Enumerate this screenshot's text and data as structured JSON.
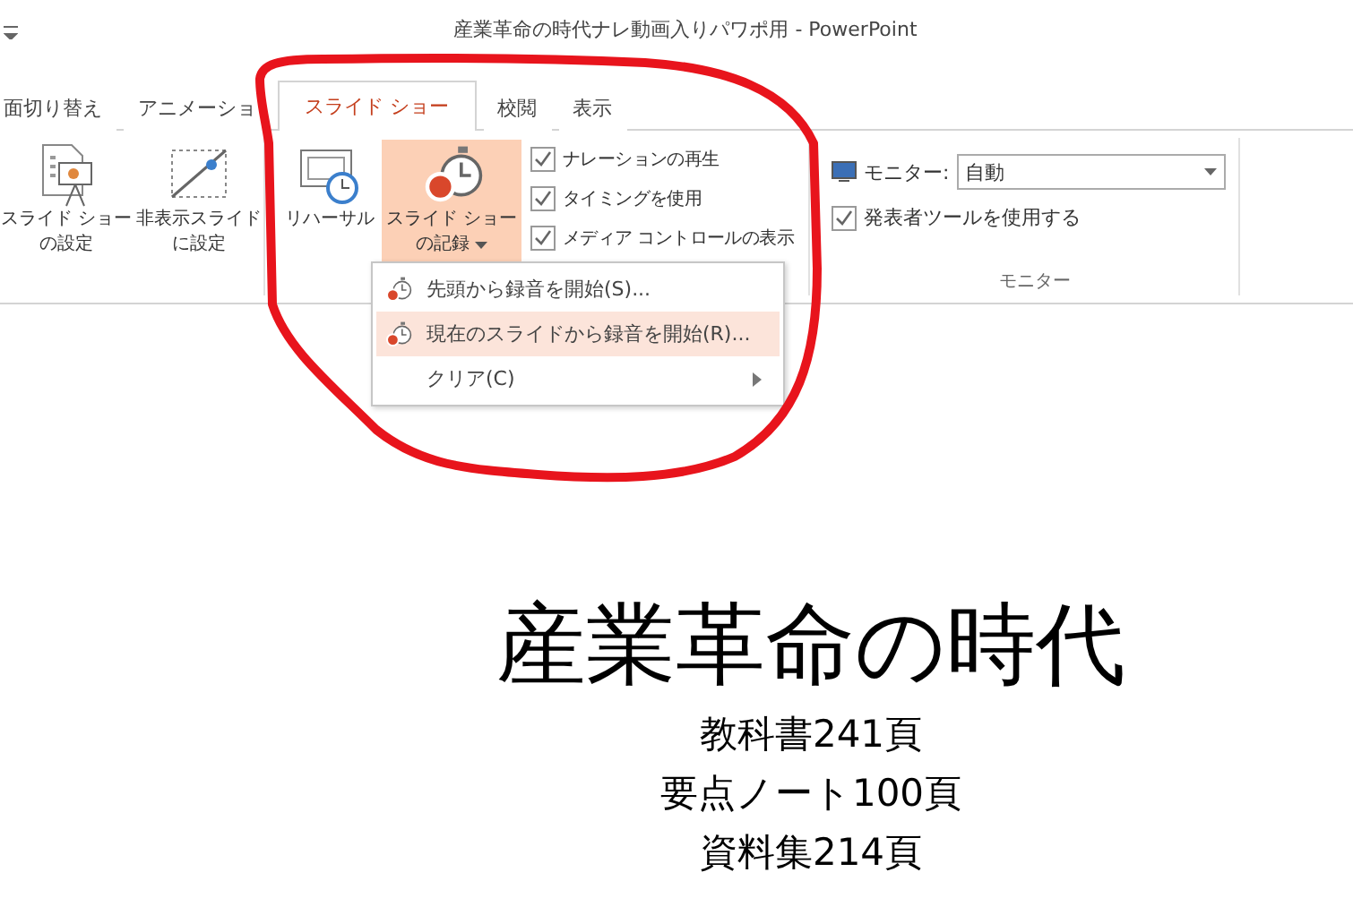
{
  "title_bar": {
    "title": "産業革命の時代ナレ動画入りパワポ用 - PowerPoint"
  },
  "tabs": [
    {
      "label": "面切り替え",
      "selected": false
    },
    {
      "label": "アニメーショ",
      "selected": false
    },
    {
      "label": "スライド ショー",
      "selected": true
    },
    {
      "label": "校閲",
      "selected": false
    },
    {
      "label": "表示",
      "selected": false
    }
  ],
  "ribbon": {
    "big_buttons": [
      {
        "kind": "setup",
        "lines": [
          "スライド ショー",
          "の設定"
        ],
        "active": false,
        "dropdown": false
      },
      {
        "kind": "hide",
        "lines": [
          "非表示スライド",
          "に設定"
        ],
        "active": false,
        "dropdown": false
      },
      {
        "kind": "rehearse",
        "lines": [
          "リハーサル"
        ],
        "active": false,
        "dropdown": false
      },
      {
        "kind": "record",
        "lines": [
          "スライド ショー",
          "の記録"
        ],
        "active": true,
        "dropdown": true
      }
    ],
    "checkboxes": [
      {
        "label": "ナレーションの再生",
        "checked": true
      },
      {
        "label": "タイミングを使用",
        "checked": true
      },
      {
        "label": "メディア コントロールの表示",
        "checked": true
      }
    ],
    "monitor": {
      "label": "モニター:",
      "value": "自動",
      "presenter": {
        "label": "発表者ツールを使用する",
        "checked": true
      },
      "group_label": "モニター"
    }
  },
  "menu": [
    {
      "kind": "record",
      "label": "先頭から録音を開始(S)...",
      "selected": false
    },
    {
      "kind": "record",
      "label": "現在のスライドから録音を開始(R)...",
      "selected": true
    },
    {
      "kind": "submenu",
      "label": "クリア(C)",
      "selected": false
    }
  ],
  "slide": {
    "title": "産業革命の時代",
    "lines": [
      "教科書241頁",
      "要点ノート100頁",
      "資料集214頁"
    ]
  }
}
